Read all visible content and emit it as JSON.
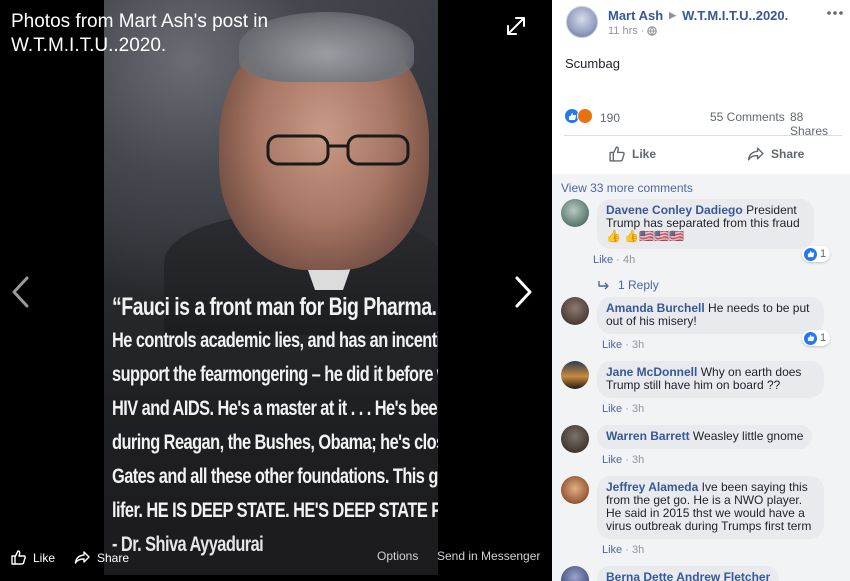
{
  "viewer": {
    "title": "Photos from Mart Ash's post in W.T.M.I.T.U..2020.",
    "photo": {
      "quote_head": "“Fauci is a front man for Big Pharma.",
      "quote_lines": [
        "He controls academic lies, and has an incentive to",
        "support the fearmongering – he did it before with",
        "HIV and AIDS.  He's a master at it . . . He's been there",
        "during Reagan, the Bushes, Obama; he's close to the",
        "Gates and all these other foundations.  This guy's a",
        "lifer.  HE IS DEEP STATE.  HE'S  DEEP STATE PHARMA”"
      ],
      "attribution": "- Dr. Shiva Ayyadurai"
    },
    "bottom": {
      "like": "Like",
      "share": "Share",
      "options": "Options",
      "send": "Send in Messenger"
    }
  },
  "post": {
    "author": "Mart Ash",
    "group": "W.T.M.I.T.U..2020.",
    "time": "11 hrs ·",
    "text": "Scumbag",
    "reaction_count": "190",
    "comments_count": "55 Comments",
    "shares_count": "88 Shares",
    "actions": {
      "like": "Like",
      "share": "Share"
    }
  },
  "comments": {
    "view_more": "View 33 more comments",
    "items": [
      {
        "name": "Davene Conley Dadiego",
        "text": "President Trump has separated from this fraud 👍",
        "text2": "👍🇺🇸🇺🇸🇺🇸",
        "like": "Like",
        "time": "4h",
        "reacts": "1"
      },
      {
        "name": "Amanda Burchell",
        "text": "He needs to be put out of his misery!",
        "like": "Like",
        "time": "3h",
        "reacts": "1"
      },
      {
        "name": "Jane McDonnell",
        "text": "Why on earth does Trump still have him on board ??",
        "like": "Like",
        "time": "3h"
      },
      {
        "name": "Warren Barrett",
        "text": "Weasley little gnome",
        "like": "Like",
        "time": "3h"
      },
      {
        "name": "Jeffrey Alameda",
        "text": "Ive been saying this from the get go. He is a NWO player. He said in 2015 thst we would have a virus outbreak during Trumps first term",
        "like": "Like",
        "time": "3h"
      },
      {
        "name": "Berna Dette Andrew Fletcher",
        "text": ""
      }
    ],
    "reply_label": "1 Reply",
    "meta_sep": " · "
  },
  "colors": {
    "link": "#385898",
    "like_blue": "#2078f4",
    "angry_orange": "#e9710f",
    "bubble_bg": "#e8eaee"
  }
}
